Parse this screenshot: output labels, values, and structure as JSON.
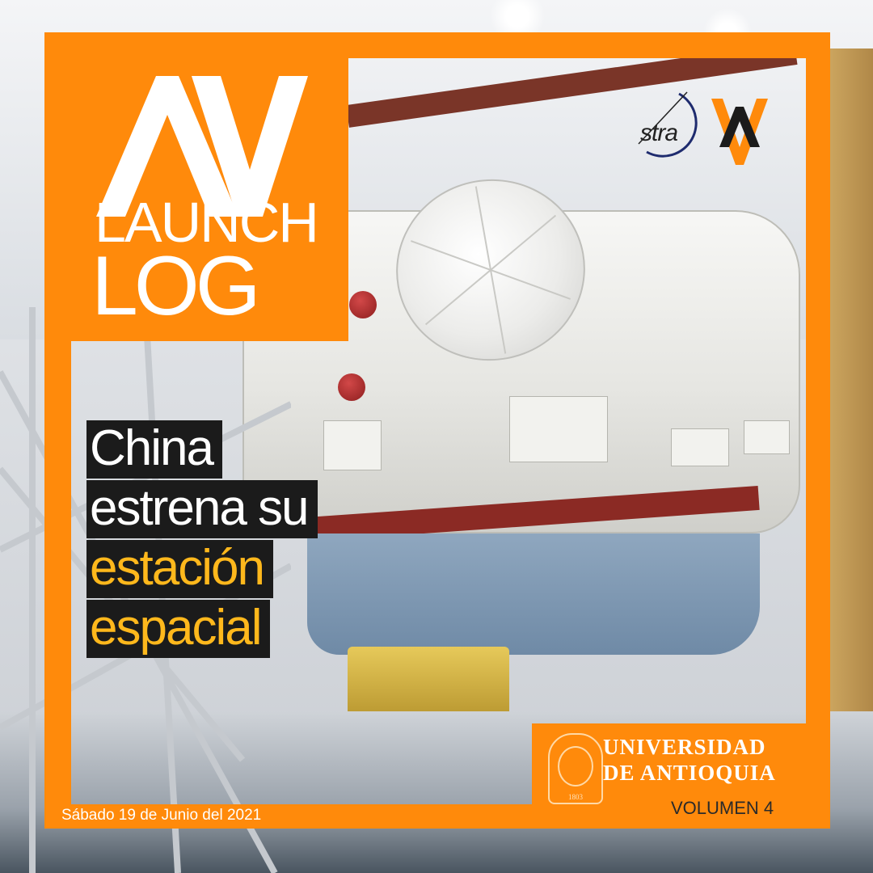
{
  "logo": {
    "symbol": "ΔV",
    "line1": "LAUNCH",
    "line2": "LOG"
  },
  "headline": {
    "line1": "China",
    "line2": "estrena su",
    "line3": "estación",
    "line4": "espacial"
  },
  "partners": {
    "astra": "stra",
    "astra_icon": "astra-logo-icon",
    "deltav_icon": "deltav-logo-icon"
  },
  "university": {
    "name_line1": "UNIVERSIDAD",
    "name_line2": "DE ANTIOQUIA",
    "seal_year": "1803",
    "seal_icon": "university-seal-icon"
  },
  "volume": "VOLUMEN 4",
  "date": "Sábado 19 de Junio del 2021",
  "colors": {
    "frame": "#ff8a0b",
    "headline_bg": "#1b1b1b",
    "headline_white": "#ffffff",
    "headline_accent": "#ffb81c"
  }
}
